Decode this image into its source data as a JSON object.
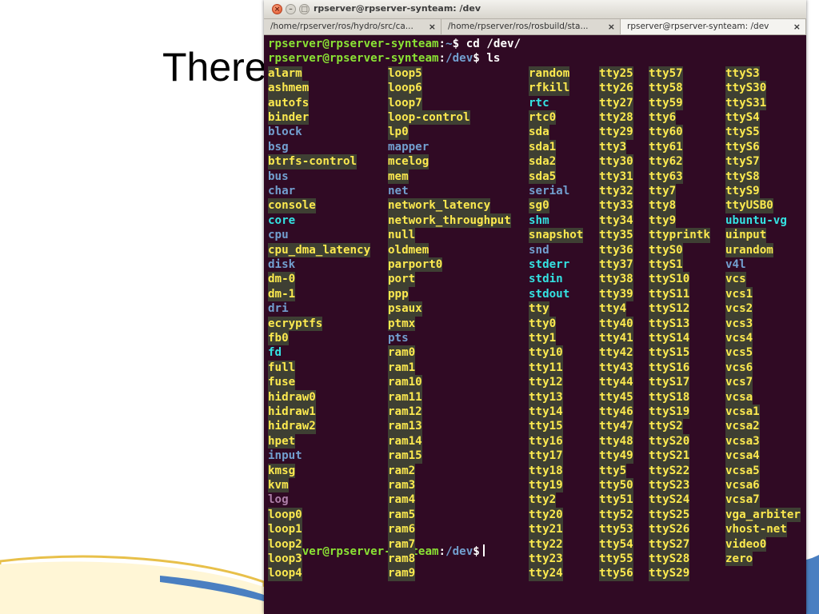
{
  "slide": {
    "title": "There"
  },
  "window": {
    "title": "rpserver@rpserver-synteam: /dev",
    "close_glyph": "×",
    "min_glyph": "–",
    "max_glyph": "□"
  },
  "tabs": [
    {
      "label": "/home/rpserver/ros/hydro/src/ca...",
      "close": "×",
      "active": false
    },
    {
      "label": "/home/rpserver/ros/rosbuild/sta...",
      "close": "×",
      "active": false
    },
    {
      "label": "rpserver@rpserver-synteam: /dev",
      "close": "×",
      "active": true
    }
  ],
  "terminal": {
    "prompt_user": "rpserver@rpserver-synteam",
    "lines": [
      {
        "path": "~",
        "command": "cd /dev/"
      },
      {
        "path": "/dev",
        "command": "ls"
      }
    ],
    "final_prompt": {
      "path": "/dev"
    },
    "columns": [
      [
        "alarm",
        "ashmem",
        "autofs",
        "binder",
        "block",
        "bsg",
        "btrfs-control",
        "bus",
        "char",
        "console",
        "core",
        "cpu",
        "cpu_dma_latency",
        "disk",
        "dm-0",
        "dm-1",
        "dri",
        "ecryptfs",
        "fb0",
        "fd",
        "full",
        "fuse",
        "hidraw0",
        "hidraw1",
        "hidraw2",
        "hpet",
        "input",
        "kmsg",
        "kvm",
        "log",
        "loop0",
        "loop1",
        "loop2",
        "loop3",
        "loop4"
      ],
      [
        "loop5",
        "loop6",
        "loop7",
        "loop-control",
        "lp0",
        "mapper",
        "mcelog",
        "mem",
        "net",
        "network_latency",
        "network_throughput",
        "null",
        "oldmem",
        "parport0",
        "port",
        "ppp",
        "psaux",
        "ptmx",
        "pts",
        "ram0",
        "ram1",
        "ram10",
        "ram11",
        "ram12",
        "ram13",
        "ram14",
        "ram15",
        "ram2",
        "ram3",
        "ram4",
        "ram5",
        "ram6",
        "ram7",
        "ram8",
        "ram9"
      ],
      [
        "random",
        "rfkill",
        "rtc",
        "rtc0",
        "sda",
        "sda1",
        "sda2",
        "sda5",
        "serial",
        "sg0",
        "shm",
        "snapshot",
        "snd",
        "stderr",
        "stdin",
        "stdout",
        "tty",
        "tty0",
        "tty1",
        "tty10",
        "tty11",
        "tty12",
        "tty13",
        "tty14",
        "tty15",
        "tty16",
        "tty17",
        "tty18",
        "tty19",
        "tty2",
        "tty20",
        "tty21",
        "tty22",
        "tty23",
        "tty24"
      ],
      [
        "tty25",
        "tty26",
        "tty27",
        "tty28",
        "tty29",
        "tty3",
        "tty30",
        "tty31",
        "tty32",
        "tty33",
        "tty34",
        "tty35",
        "tty36",
        "tty37",
        "tty38",
        "tty39",
        "tty4",
        "tty40",
        "tty41",
        "tty42",
        "tty43",
        "tty44",
        "tty45",
        "tty46",
        "tty47",
        "tty48",
        "tty49",
        "tty5",
        "tty50",
        "tty51",
        "tty52",
        "tty53",
        "tty54",
        "tty55",
        "tty56"
      ],
      [
        "tty57",
        "tty58",
        "tty59",
        "tty6",
        "tty60",
        "tty61",
        "tty62",
        "tty63",
        "tty7",
        "tty8",
        "tty9",
        "ttyprintk",
        "ttyS0",
        "ttyS1",
        "ttyS10",
        "ttyS11",
        "ttyS12",
        "ttyS13",
        "ttyS14",
        "ttyS15",
        "ttyS16",
        "ttyS17",
        "ttyS18",
        "ttyS19",
        "ttyS2",
        "ttyS20",
        "ttyS21",
        "ttyS22",
        "ttyS23",
        "ttyS24",
        "ttyS25",
        "ttyS26",
        "ttyS27",
        "ttyS28",
        "ttyS29"
      ],
      [
        "ttyS3",
        "ttyS30",
        "ttyS31",
        "ttyS4",
        "ttyS5",
        "ttyS6",
        "ttyS7",
        "ttyS8",
        "ttyS9",
        "ttyUSB0",
        "ubuntu-vg",
        "uinput",
        "urandom",
        "v4l",
        "vcs",
        "vcs1",
        "vcs2",
        "vcs3",
        "vcs4",
        "vcs5",
        "vcs6",
        "vcs7",
        "vcsa",
        "vcsa1",
        "vcsa2",
        "vcsa3",
        "vcsa4",
        "vcsa5",
        "vcsa6",
        "vcsa7",
        "vga_arbiter",
        "vhost-net",
        "video0",
        "zero"
      ]
    ],
    "directories": [
      "block",
      "bsg",
      "bus",
      "char",
      "cpu",
      "disk",
      "dri",
      "input",
      "mapper",
      "net",
      "pts",
      "snd",
      "serial",
      "v4l"
    ],
    "symlinks": [
      "core",
      "fd",
      "rtc",
      "shm",
      "stderr",
      "stdin",
      "stdout",
      "ubuntu-vg"
    ],
    "plain_files": [
      "snapshot"
    ],
    "sockets": [
      "log"
    ],
    "colors": {
      "background": "#300a24",
      "prompt_user": "#8ae234",
      "prompt_path": "#729fcf",
      "device": "#fce94f",
      "device_bg": "#3e3f33",
      "directory": "#729fcf",
      "symlink": "#34e2e2",
      "socket": "#ad7fa8"
    }
  }
}
